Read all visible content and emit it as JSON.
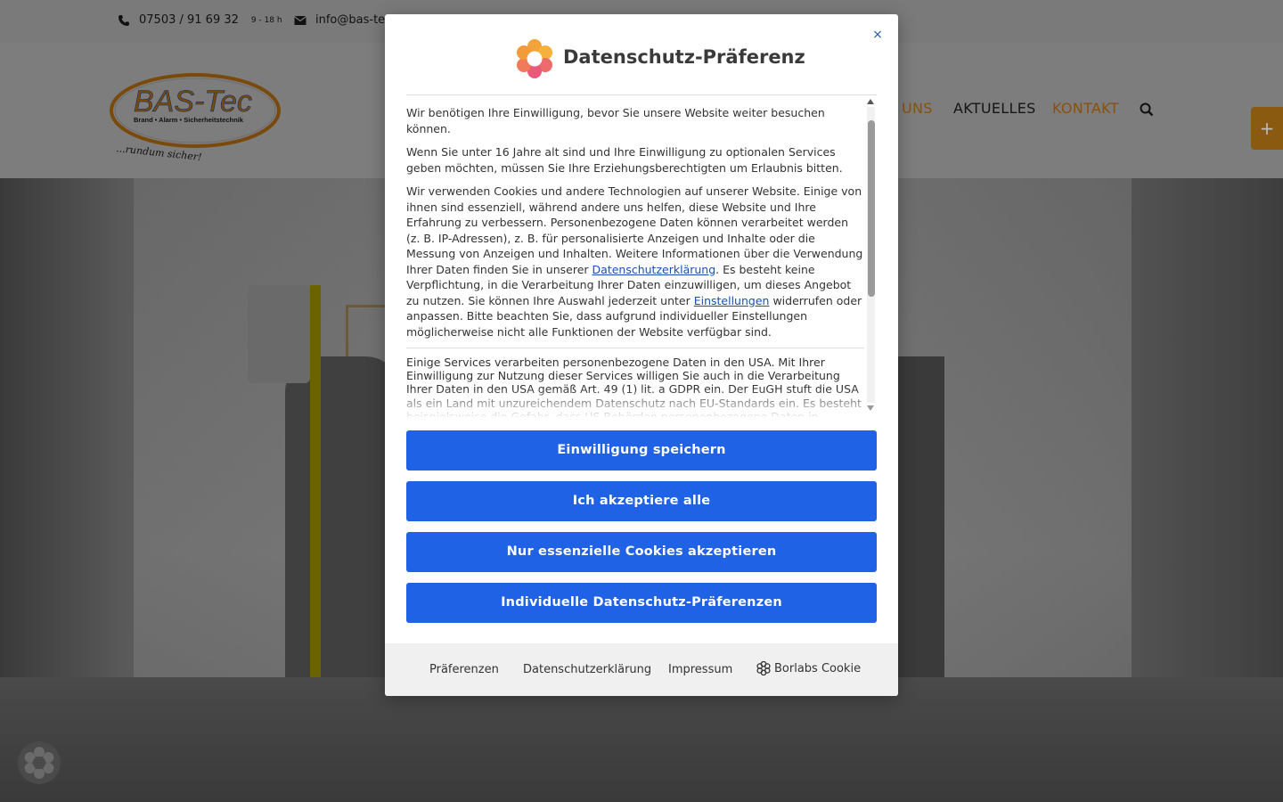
{
  "topbar": {
    "phone": "07503 / 91 69 32",
    "hours": "9 - 18 h",
    "email": "info@bas-tec"
  },
  "logo": {
    "brand": "BAS-Tec",
    "tagline": "Brand • Alarm • Sicherheitstechnik",
    "slogan": "...rundum sicher!"
  },
  "nav": {
    "partial": "UNS",
    "aktuelles": "AKTUELLES",
    "kontakt": "KONTAKT"
  },
  "side_tab": {
    "label": "+"
  },
  "modal": {
    "title": "Datenschutz-Präferenz",
    "close": "×",
    "paragraphs": {
      "p1": "Wir benötigen Ihre Einwilligung, bevor Sie unsere Website weiter besuchen können.",
      "p2": "Wenn Sie unter 16 Jahre alt sind und Ihre Einwilligung zu optionalen Services geben möchten, müssen Sie Ihre Erziehungsberechtigten um Erlaubnis bitten.",
      "p3_a": "Wir verwenden Cookies und andere Technologien auf unserer Website. Einige von ihnen sind essenziell, während andere uns helfen, diese Website und Ihre Erfahrung zu verbessern. Personenbezogene Daten können verarbeitet werden (z. B. IP-Adressen), z. B. für personalisierte Anzeigen und Inhalte oder die Messung von Anzeigen und Inhalten. Weitere Informationen über die Verwendung Ihrer Daten finden Sie in unserer ",
      "p3_link1": "Datenschutzerklärung",
      "p3_b": ". Es besteht keine Verpflichtung, in die Verarbeitung Ihrer Daten einzuwilligen, um dieses Angebot zu nutzen. Sie können Ihre Auswahl jederzeit unter ",
      "p3_link2": "Einstellungen",
      "p3_c": " widerrufen oder anpassen. Bitte beachten Sie, dass aufgrund individueller Einstellungen möglicherweise nicht alle Funktionen der Website verfügbar sind.",
      "p4": "Einige Services verarbeiten personenbezogene Daten in den USA. Mit Ihrer Einwilligung zur Nutzung dieser Services willigen Sie auch in die Verarbeitung Ihrer Daten in den USA gemäß Art. 49 (1) lit. a GDPR ein. Der EuGH stuft die USA als ein Land mit unzureichendem Datenschutz nach EU-Standards ein. Es besteht beispielsweise die Gefahr, dass US-Behörden personenbezogene Daten in Überwachungsprogrammen verarbeiten, ohne bestehende Klagemöglichkeit für Europäer."
    },
    "buttons": {
      "save": "Einwilligung speichern",
      "accept_all": "Ich akzeptiere alle",
      "essential_only": "Nur essenzielle Cookies akzeptieren",
      "individual": "Individuelle Datenschutz-Präferenzen"
    },
    "footer": {
      "preferences": "Präferenzen",
      "privacy": "Datenschutzerklärung",
      "imprint": "Impressum",
      "brand": "Borlabs Cookie"
    }
  },
  "colors": {
    "primary_button": "#1f62e6",
    "link": "#1a4fb8",
    "accent_orange": "#d9851a"
  }
}
